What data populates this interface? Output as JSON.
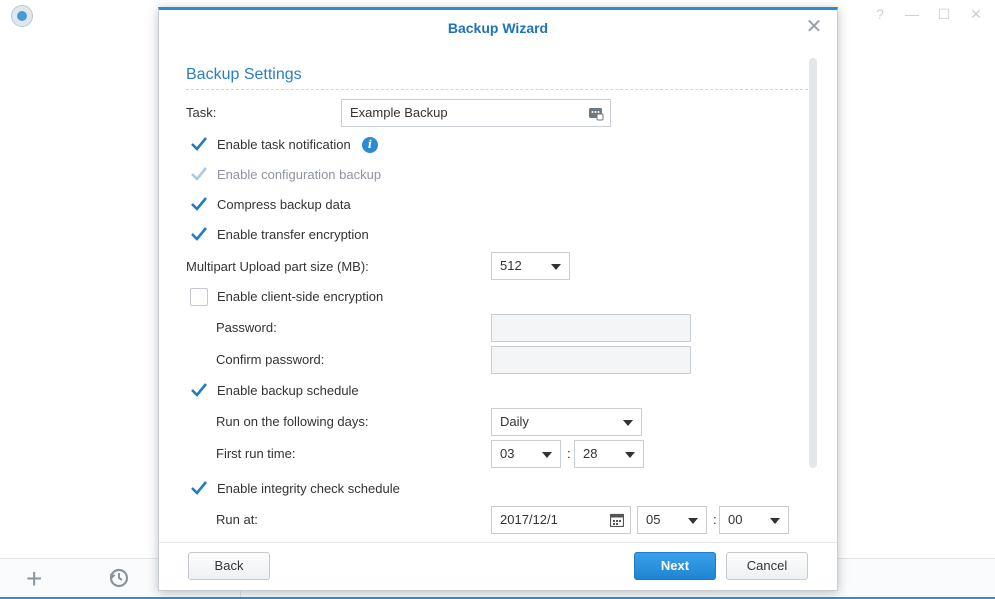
{
  "window_controls": [
    "?",
    "—",
    "☐",
    "✕"
  ],
  "dialog": {
    "title": "Backup Wizard",
    "section_title": "Backup Settings",
    "task": {
      "label": "Task:",
      "value": "Example Backup"
    },
    "options": {
      "task_notification": {
        "label": "Enable task notification",
        "checked": true
      },
      "config_backup": {
        "label": "Enable configuration backup",
        "checked": true,
        "disabled": true
      },
      "compress": {
        "label": "Compress backup data",
        "checked": true
      },
      "transfer_encryption": {
        "label": "Enable transfer encryption",
        "checked": true
      }
    },
    "multipart": {
      "label": "Multipart Upload part size (MB):",
      "value": "512"
    },
    "client_encryption": {
      "label": "Enable client-side encryption",
      "checked": false,
      "password_label": "Password:",
      "password_value": "",
      "confirm_label": "Confirm password:",
      "confirm_value": ""
    },
    "backup_schedule": {
      "label": "Enable backup schedule",
      "checked": true,
      "days_label": "Run on the following days:",
      "days_value": "Daily",
      "time_label": "First run time:",
      "hour": "03",
      "minute": "28",
      "sep": ":"
    },
    "integrity_schedule": {
      "label": "Enable integrity check schedule",
      "checked": true,
      "run_at_label": "Run at:",
      "date": "2017/12/1",
      "hour": "05",
      "minute": "00",
      "sep": ":"
    },
    "buttons": {
      "back": "Back",
      "next": "Next",
      "cancel": "Cancel"
    }
  },
  "colors": {
    "accent": "#2b8ad4",
    "title": "#1d73bb",
    "check": "#1f7bc6"
  }
}
